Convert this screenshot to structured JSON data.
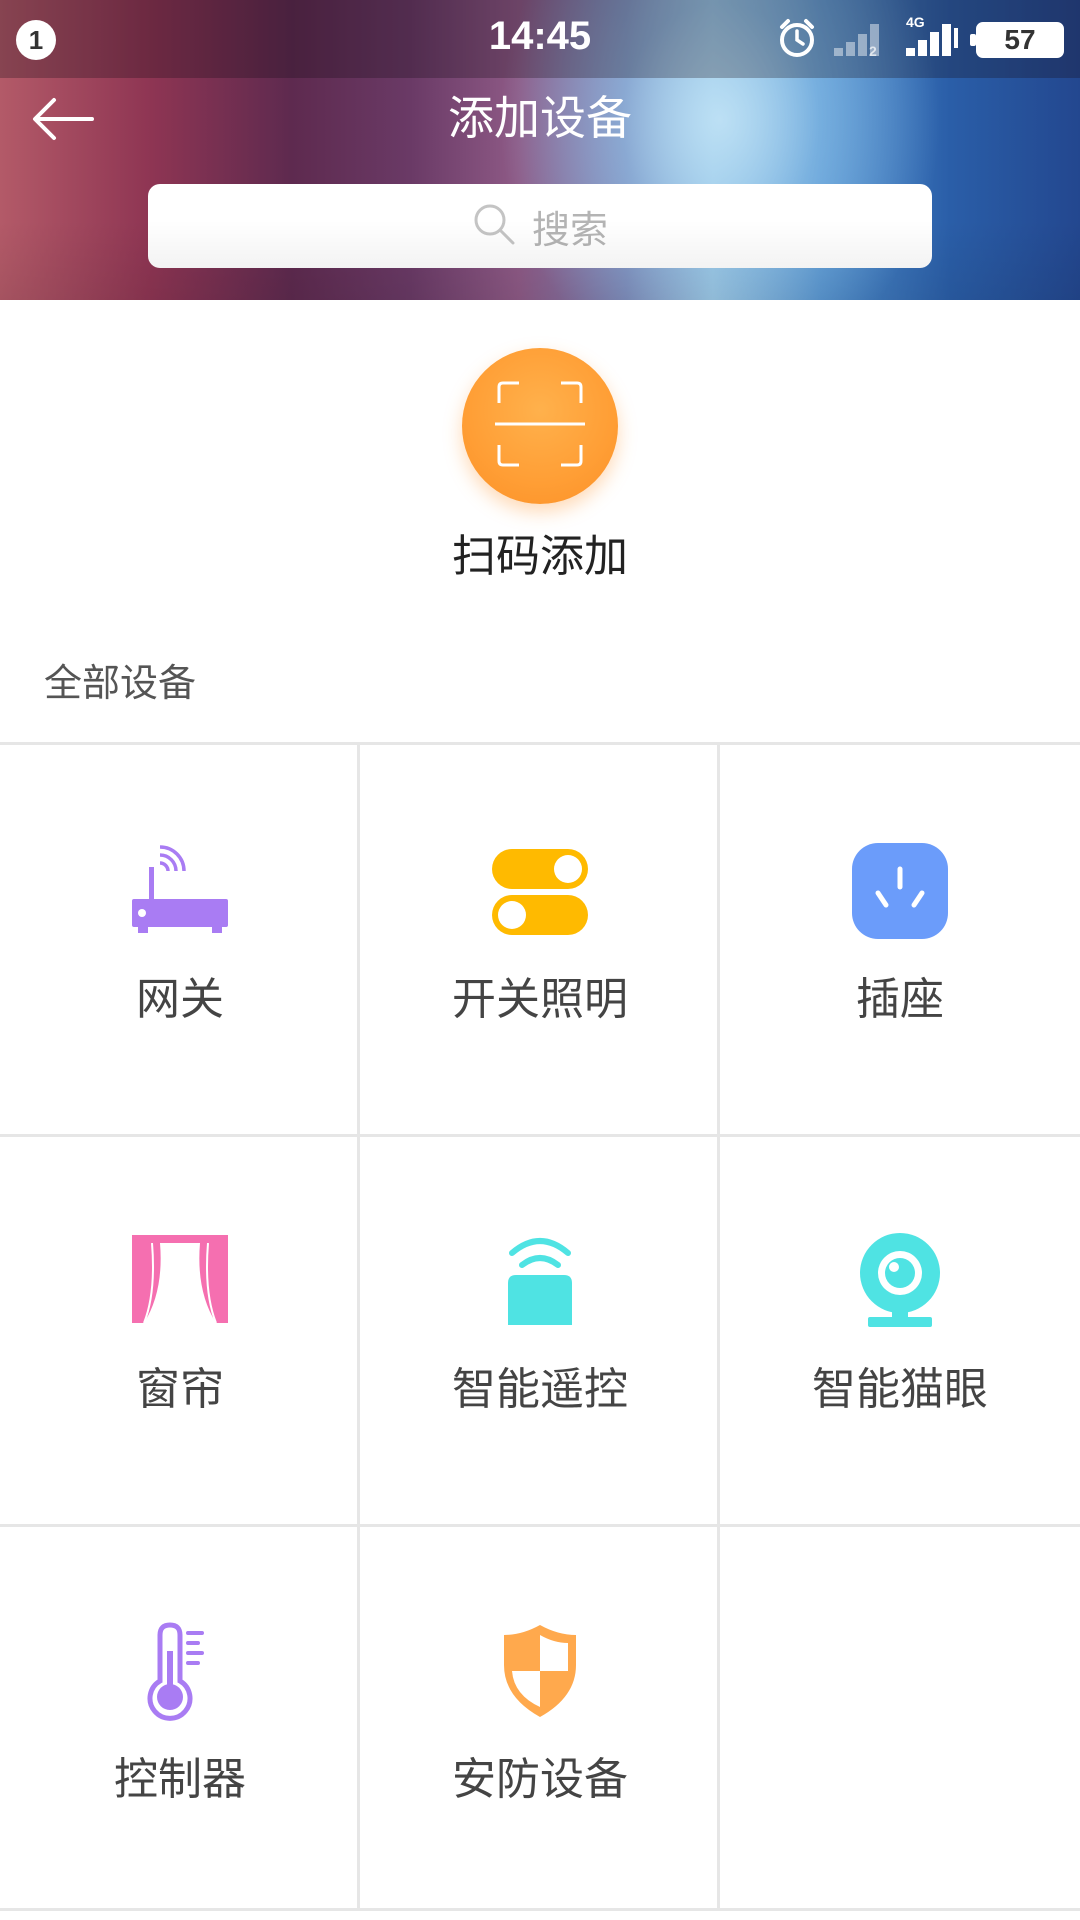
{
  "status_bar": {
    "notification_count": "1",
    "time": "14:45",
    "network": "4G",
    "battery": "57",
    "icons": [
      "alarm-icon",
      "signal-sim2-icon",
      "signal-4g-icon",
      "battery-icon"
    ]
  },
  "nav": {
    "back_icon": "arrow-left-icon",
    "title": "添加设备"
  },
  "search": {
    "icon": "search-icon",
    "placeholder": "搜索"
  },
  "scan": {
    "icon": "scan-icon",
    "label": "扫码添加",
    "color": "#ff9e35"
  },
  "section": {
    "title": "全部设备"
  },
  "devices": [
    {
      "label": "网关",
      "icon": "router-icon",
      "color": "#a97cf3"
    },
    {
      "label": "开关照明",
      "icon": "toggle-switch-icon",
      "color": "#ffba00"
    },
    {
      "label": "插座",
      "icon": "socket-icon",
      "color": "#6b9cfa"
    },
    {
      "label": "窗帘",
      "icon": "curtain-icon",
      "color": "#f56fb0"
    },
    {
      "label": "智能遥控",
      "icon": "remote-control-icon",
      "color": "#4fe3e3"
    },
    {
      "label": "智能猫眼",
      "icon": "webcam-icon",
      "color": "#4fe3e3"
    },
    {
      "label": "控制器",
      "icon": "thermometer-icon",
      "color": "#a97cf3"
    },
    {
      "label": "安防设备",
      "icon": "shield-icon",
      "color": "#ffa94d"
    }
  ]
}
